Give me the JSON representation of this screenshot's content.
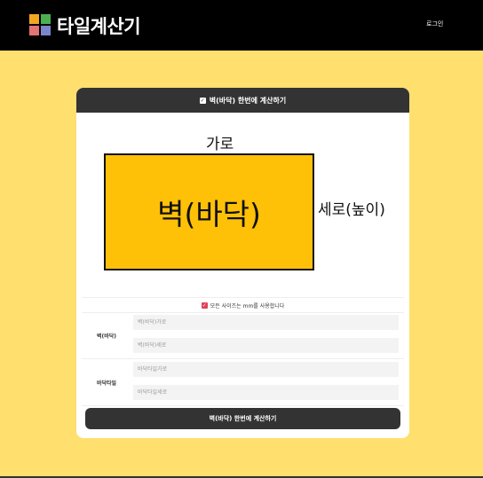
{
  "header": {
    "brand": "타일계산기",
    "login_label": "로그인",
    "logo_colors": [
      "#f4a623",
      "#4caf50",
      "#e57373",
      "#7986cb"
    ]
  },
  "card": {
    "title": "벽(바닥) 한번에 계산하기",
    "diagram": {
      "width_label": "가로",
      "height_label": "세로(높이)",
      "center_label": "벽(바닥)"
    },
    "note": "모든 사이즈는 mm를 사용합니다",
    "groups": [
      {
        "label": "벽(바닥)",
        "width_placeholder": "벽(바닥)가로",
        "height_placeholder": "벽(바닥)세로"
      },
      {
        "label": "바닥타일",
        "width_placeholder": "바닥타일가로",
        "height_placeholder": "바닥타일세로"
      }
    ],
    "submit_label": "벽(바닥) 한번에 계산하기"
  },
  "colors": {
    "background": "#ffdf6e",
    "accent": "#ffc107",
    "header": "#333333"
  }
}
